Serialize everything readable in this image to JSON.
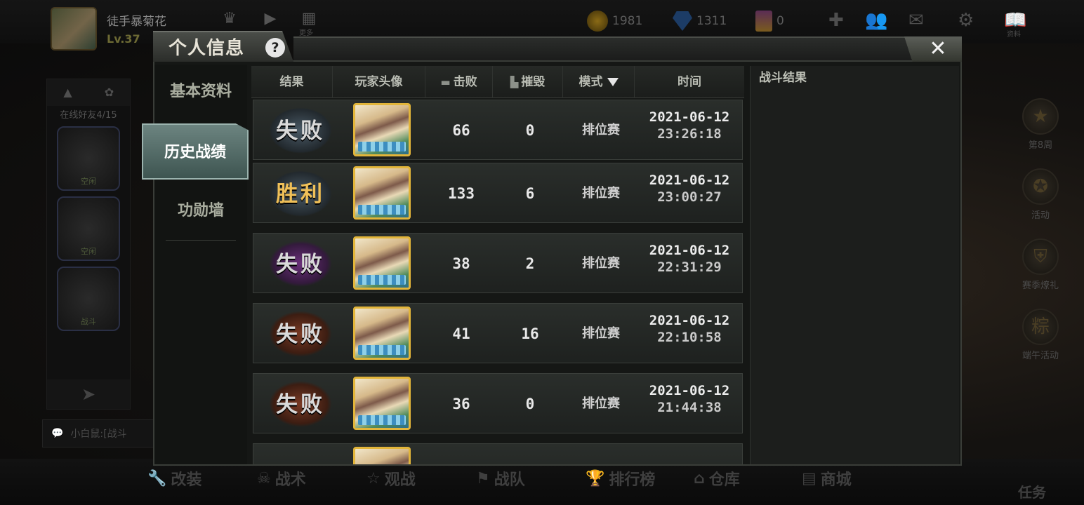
{
  "hud": {
    "player_name": "徒手暴菊花",
    "level": "Lv.37",
    "currency_gold": "1981",
    "currency_diamond": "1311",
    "currency_card": "0",
    "more_label": "更多",
    "data_label": "资料"
  },
  "friends": {
    "online": "在线好友4/15",
    "items": [
      "空闲",
      "空闲",
      "战斗"
    ]
  },
  "chat": {
    "preview": "小白鼠:[战斗"
  },
  "bottom_nav": [
    "改装",
    "战术",
    "观战",
    "战队",
    "排行榜",
    "仓库",
    "商城"
  ],
  "task_label": "任务",
  "side_events": [
    "第8周",
    "活动",
    "赛季燎礼",
    "端午活动"
  ],
  "modal": {
    "title": "个人信息",
    "help": "?",
    "close": "✕",
    "tabs": [
      "基本资料",
      "历史战绩",
      "功勋墙"
    ],
    "active_tab": "历史战绩",
    "columns": {
      "result": "结果",
      "avatar": "玩家头像",
      "kills": "击败",
      "destroy": "摧毁",
      "mode": "模式",
      "time": "时间"
    },
    "rows": [
      {
        "result": "失败",
        "kills": "66",
        "destroy": "0",
        "mode": "排位赛",
        "date": "2021-06-12",
        "time": "23:26:18"
      },
      {
        "result": "胜利",
        "kills": "133",
        "destroy": "6",
        "mode": "排位赛",
        "date": "2021-06-12",
        "time": "23:00:27"
      },
      {
        "result": "失败",
        "kills": "38",
        "destroy": "2",
        "mode": "排位赛",
        "date": "2021-06-12",
        "time": "22:31:29"
      },
      {
        "result": "失败",
        "kills": "41",
        "destroy": "16",
        "mode": "排位赛",
        "date": "2021-06-12",
        "time": "22:10:58"
      },
      {
        "result": "失败",
        "kills": "36",
        "destroy": "0",
        "mode": "排位赛",
        "date": "2021-06-12",
        "time": "21:44:38"
      }
    ],
    "result_panel_title": "战斗结果"
  }
}
